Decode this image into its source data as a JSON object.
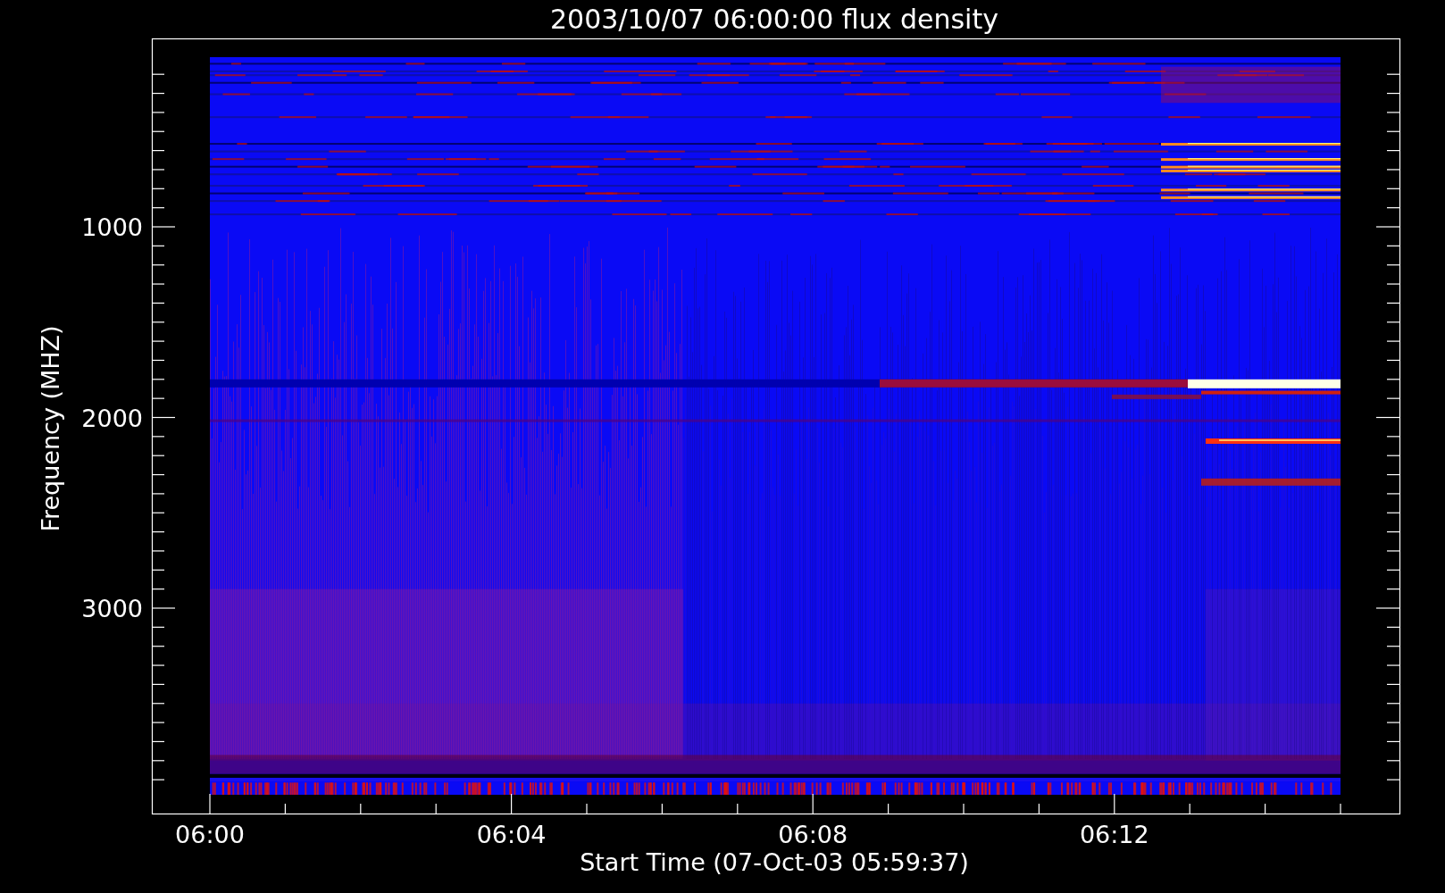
{
  "title": "2003/10/07 06:00:00 flux density",
  "y_axis": {
    "label": "Frequency (MHZ)",
    "ticks": [
      "1000",
      "2000",
      "3000"
    ]
  },
  "x_axis": {
    "label": "Start Time (07-Oct-03 05:59:37)",
    "ticks": [
      "06:00",
      "06:04",
      "06:08",
      "06:12"
    ]
  }
}
